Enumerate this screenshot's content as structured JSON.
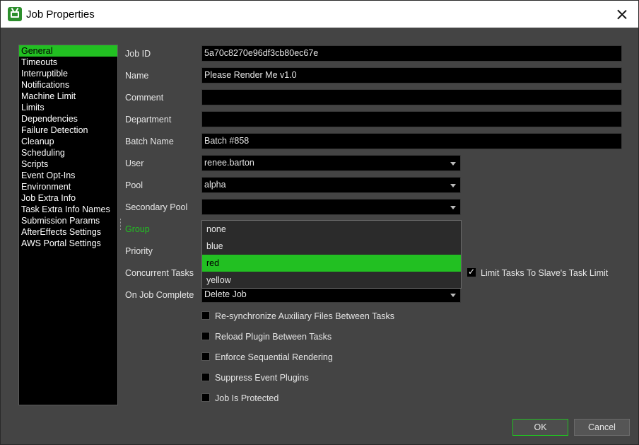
{
  "window": {
    "title": "Job Properties"
  },
  "sidebar": {
    "items": [
      "General",
      "Timeouts",
      "Interruptible",
      "Notifications",
      "Machine Limit",
      "Limits",
      "Dependencies",
      "Failure Detection",
      "Cleanup",
      "Scheduling",
      "Scripts",
      "Event Opt-Ins",
      "Environment",
      "Job Extra Info",
      "Task Extra Info Names",
      "Submission Params",
      "AfterEffects Settings",
      "AWS Portal Settings"
    ],
    "selected": "General"
  },
  "form": {
    "job_id_label": "Job ID",
    "job_id_value": "5a70c8270e96df3cb80ec67e",
    "name_label": "Name",
    "name_value": "Please Render Me v1.0",
    "comment_label": "Comment",
    "comment_value": "",
    "department_label": "Department",
    "department_value": "",
    "batch_name_label": "Batch Name",
    "batch_name_value": "Batch #858",
    "user_label": "User",
    "user_value": "renee.barton",
    "pool_label": "Pool",
    "pool_value": "alpha",
    "secondary_pool_label": "Secondary Pool",
    "secondary_pool_value": "",
    "group_label": "Group",
    "priority_label": "Priority",
    "concurrent_tasks_label": "Concurrent Tasks",
    "limit_tasks_label": "Limit Tasks To Slave's Task Limit",
    "on_job_complete_label": "On Job Complete",
    "on_job_complete_value": "Delete Job",
    "checkboxes": [
      "Re-synchronize Auxiliary Files Between Tasks",
      "Reload Plugin Between Tasks",
      "Enforce Sequential Rendering",
      "Suppress Event Plugins",
      "Job Is Protected"
    ]
  },
  "group_dropdown": {
    "options": [
      "none",
      "blue",
      "red",
      "yellow"
    ],
    "selected": "red"
  },
  "buttons": {
    "ok": "OK",
    "cancel": "Cancel"
  },
  "colors": {
    "accent": "#22c022",
    "background": "#444444",
    "field": "#000000"
  }
}
